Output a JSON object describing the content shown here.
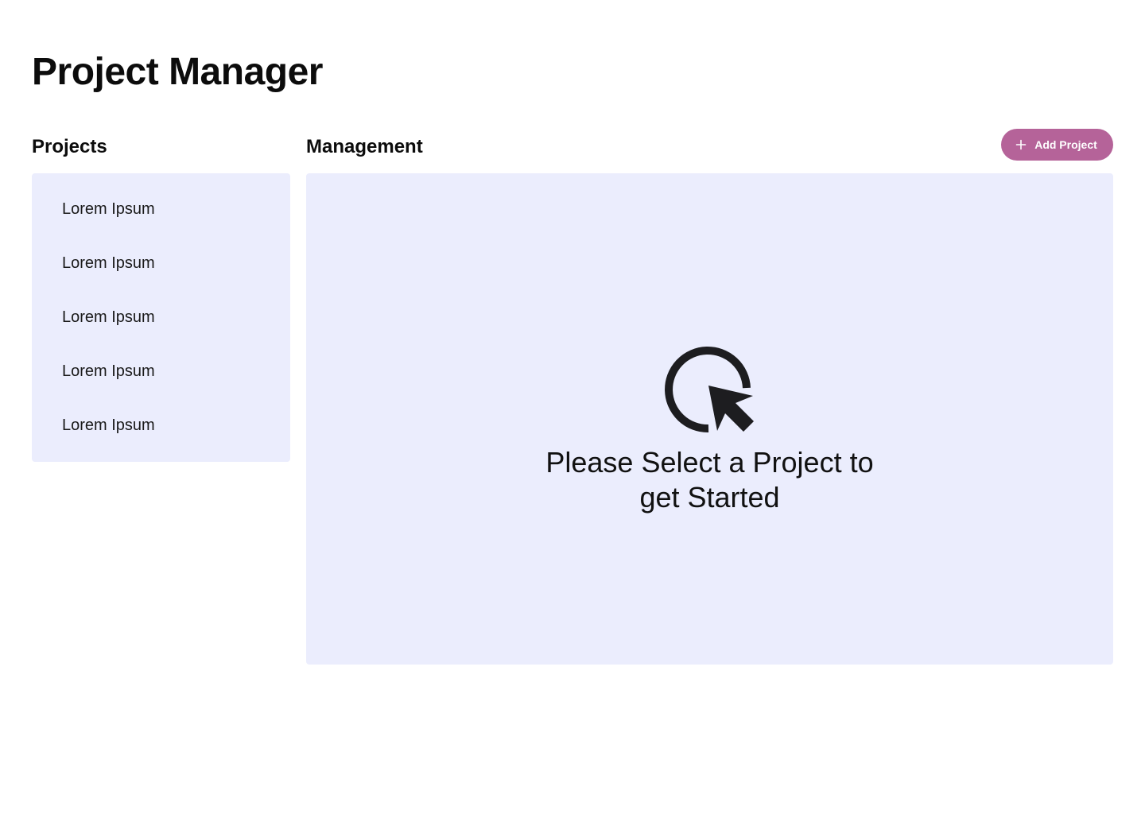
{
  "app": {
    "title": "Project Manager"
  },
  "sidebar": {
    "heading": "Projects",
    "items": [
      {
        "label": "Lorem Ipsum"
      },
      {
        "label": "Lorem Ipsum"
      },
      {
        "label": "Lorem Ipsum"
      },
      {
        "label": "Lorem Ipsum"
      },
      {
        "label": "Lorem Ipsum"
      }
    ]
  },
  "main": {
    "heading": "Management",
    "add_button": {
      "label": "Add Project",
      "icon": "plus-icon"
    },
    "empty_state": {
      "icon": "cursor-click-icon",
      "message": "Please Select a Project to get Started"
    }
  },
  "colors": {
    "accent": "#b56399",
    "panel_background": "#ebedfd",
    "text": "#111111"
  }
}
